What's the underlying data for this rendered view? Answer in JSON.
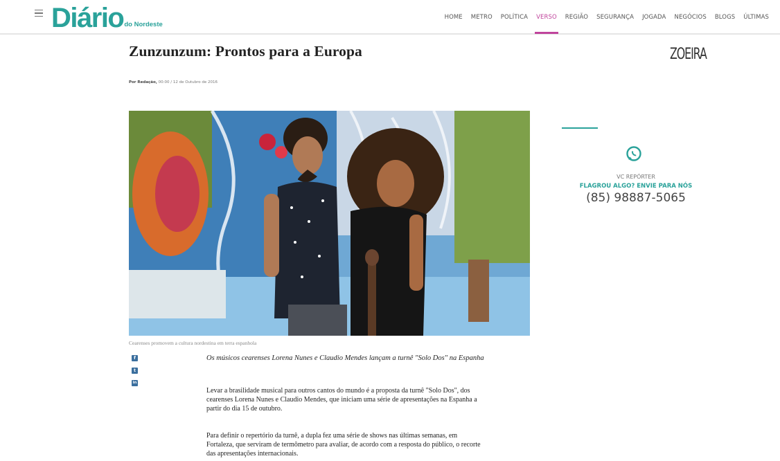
{
  "header": {
    "logo_main": "Diário",
    "logo_sub": "do Nordeste",
    "nav": [
      "HOME",
      "METRO",
      "POLÍTICA",
      "VERSO",
      "REGIÃO",
      "SEGURANÇA",
      "JOGADA",
      "NEGÓCIOS",
      "BLOGS",
      "ÚLTIMAS"
    ],
    "active_nav": "VERSO",
    "brand_color": "#2aa29a",
    "accent_color": "#c0449c"
  },
  "article": {
    "title": "Zunzunzum: Prontos para a Europa",
    "byline_author": "Por Redação,",
    "byline_date": " 00:00 / 12 de Outubro de 2016",
    "photo_caption": "Cearenses promovem a cultura nordestina em terra espanhola",
    "share": [
      "facebook-icon",
      "twitter-icon",
      "linkedin-icon"
    ],
    "lead": "Os músicos cearenses Lorena Nunes e Claudio Mendes lançam a turnê \"Solo Dos\" na Espanha",
    "paragraphs": [
      "Levar a brasilidade musical para outros cantos do mundo é a proposta da turnê \"Solo Dos\", dos cearenses Lorena Nunes e Claudio Mendes, que iniciam uma série de apresentações na Espanha a partir do dia 15 de outubro.",
      "Para definir o repertório da turnê, a dupla fez uma série de shows nas últimas semanas, em Fortaleza, que serviram de termômetro para avaliar, de acordo com a resposta do público, o recorte das apresentações internacionais."
    ]
  },
  "sidebar": {
    "section_title": "ZOEIRA",
    "reporter_label": "VC REPÓRTER",
    "reporter_cta": "FLAGROU ALGO? ENVIE PARA NÓS",
    "reporter_phone": "(85) 98887-5065",
    "whatsapp_icon": "whatsapp-icon"
  }
}
